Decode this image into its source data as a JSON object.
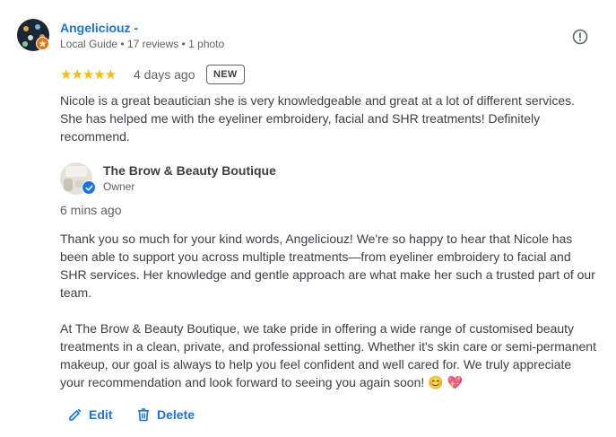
{
  "review": {
    "reviewer_name": "Angeliciouz -",
    "reviewer_meta": "Local Guide • 17 reviews • 1 photo",
    "rating_stars": "★★★★★",
    "rating": 5,
    "time": "4 days ago",
    "badge": "NEW",
    "text": "Nicole is a great beautician she is very knowledgeable and great at a lot of different services. She has helped me with the eyeliner embroidery, facial and SHR treatments! Definitely recommend."
  },
  "reply": {
    "owner_name": "The Brow & Beauty Boutique",
    "owner_role": "Owner",
    "time": "6 mins ago",
    "paragraph1": "Thank you so much for your kind words, Angeliciouz! We're so happy to hear that Nicole has been able to support you across multiple treatments—from eyeliner embroidery to facial and SHR services. Her knowledge and gentle approach are what make her such a trusted part of our team.",
    "paragraph2": "At The Brow & Beauty Boutique, we take pride in offering a wide range of customised beauty treatments in a clean, private, and professional setting. Whether it's skin care or semi-permanent makeup, our goal is always to help you feel confident and well cared for. We truly appreciate your recommendation and look forward to seeing you again soon! 😊 💖"
  },
  "actions": {
    "edit_label": "Edit",
    "delete_label": "Delete"
  },
  "icons": {
    "report": "report-flag-icon",
    "edit": "pencil-icon",
    "delete": "trash-icon",
    "local_guide": "local-guide-badge-icon",
    "verified": "verified-check-icon"
  },
  "colors": {
    "link": "#1a73e8",
    "star": "#fbbc04",
    "local_guide_badge": "#e8710a",
    "text": "#3c4043",
    "secondary_text": "#5f6368"
  }
}
